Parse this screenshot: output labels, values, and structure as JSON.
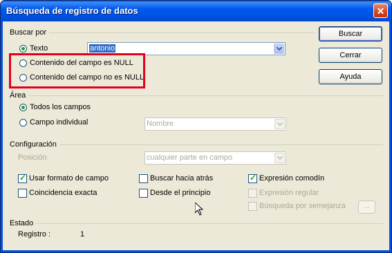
{
  "window": {
    "title": "Búsqueda de registro de datos",
    "close_glyph": "✕"
  },
  "search_for": {
    "group_label": "Buscar por",
    "option_text_label": "Texto",
    "text_value": "antonio",
    "option_null_label": "Contenido del campo es NULL",
    "option_not_null_label": "Contenido del campo no es NULL"
  },
  "area": {
    "group_label": "Área",
    "all_fields_label": "Todos los campos",
    "single_field_label": "Campo individual",
    "single_field_value": "Nombre"
  },
  "config": {
    "group_label": "Configuración",
    "position_label": "Posición",
    "position_value": "cualquier parte en campo",
    "use_field_format_label": "Usar formato de campo",
    "exact_match_label": "Coincidencia exacta",
    "search_backwards_label": "Buscar hacia atrás",
    "from_start_label": "Desde el principio",
    "wildcard_label": "Expresión comodín",
    "regex_label": "Expresión regular",
    "similarity_label": "Búsqueda por semejanza",
    "similarity_button_label": "..."
  },
  "status": {
    "group_label": "Estado",
    "record_label": "Registro :",
    "record_value": "1"
  },
  "buttons": {
    "search_label": "Buscar",
    "close_label": "Cerrar",
    "help_label": "Ayuda"
  },
  "colors": {
    "title_bar": "#0054e3",
    "highlight_box": "#e3001b",
    "dialog_bg": "#ece9d8"
  }
}
